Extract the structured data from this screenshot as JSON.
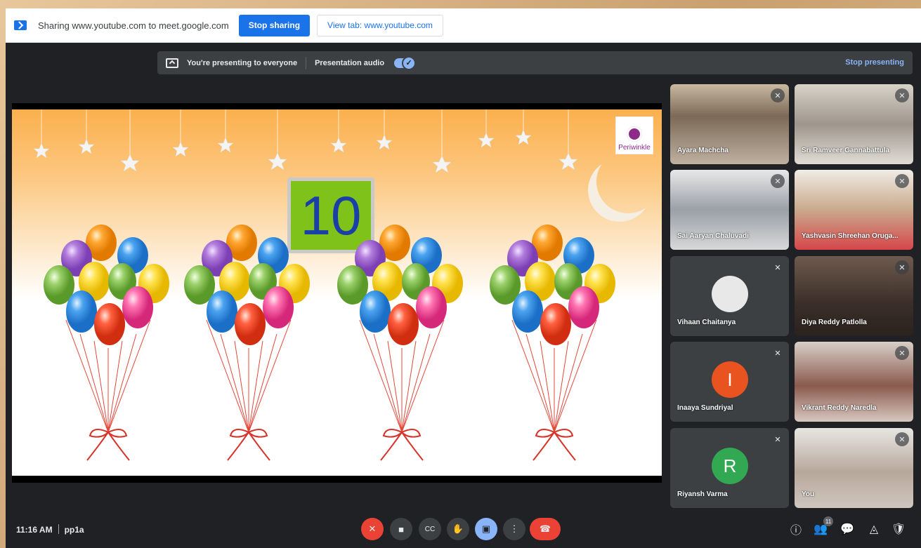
{
  "sharebar": {
    "sharing_text": "Sharing www.youtube.com to meet.google.com",
    "stop_sharing": "Stop sharing",
    "view_tab": "View tab: www.youtube.com"
  },
  "present_bar": {
    "presenting_text": "You're presenting to everyone",
    "audio_label": "Presentation audio",
    "audio_on": true,
    "stop_presenting": "Stop presenting"
  },
  "slide": {
    "logo_text": "Periwinkle",
    "number": "10",
    "balloon_bunches": 4
  },
  "participants": [
    {
      "name": "Ayara Machcha",
      "muted": true,
      "video": true
    },
    {
      "name": "Sri Ramveer Gannabattula",
      "muted": true,
      "video": true
    },
    {
      "name": "Sai Aaryan Chaluvadi",
      "muted": true,
      "video": true
    },
    {
      "name": "Yashvasin Shreehan Oruga...",
      "muted": true,
      "video": true
    },
    {
      "name": "Vihaan Chaitanya",
      "muted": true,
      "video": false
    },
    {
      "name": "Diya Reddy Patlolla",
      "muted": true,
      "video": true
    },
    {
      "name": "Inaaya Sundriyal",
      "muted": true,
      "video": false,
      "initial": "I",
      "color": "#e8531f"
    },
    {
      "name": "Vikrant Reddy Naredla",
      "muted": true,
      "video": true
    },
    {
      "name": "Riyansh Varma",
      "muted": true,
      "video": false,
      "initial": "R",
      "color": "#33a852"
    },
    {
      "name": "You",
      "muted": true,
      "video": true
    }
  ],
  "bottom_bar": {
    "time": "11:16 AM",
    "meeting_code": "pp1a",
    "participant_count": "11"
  },
  "icons": {
    "mic_off": "mic-off-icon",
    "camera": "camera-icon",
    "captions": "captions-icon",
    "raise_hand": "raise-hand-icon",
    "present": "present-icon",
    "more": "more-options-icon",
    "leave": "leave-call-icon",
    "info": "info-icon",
    "people": "people-icon",
    "chat": "chat-icon",
    "activities": "activities-icon",
    "host_controls": "host-controls-icon"
  }
}
